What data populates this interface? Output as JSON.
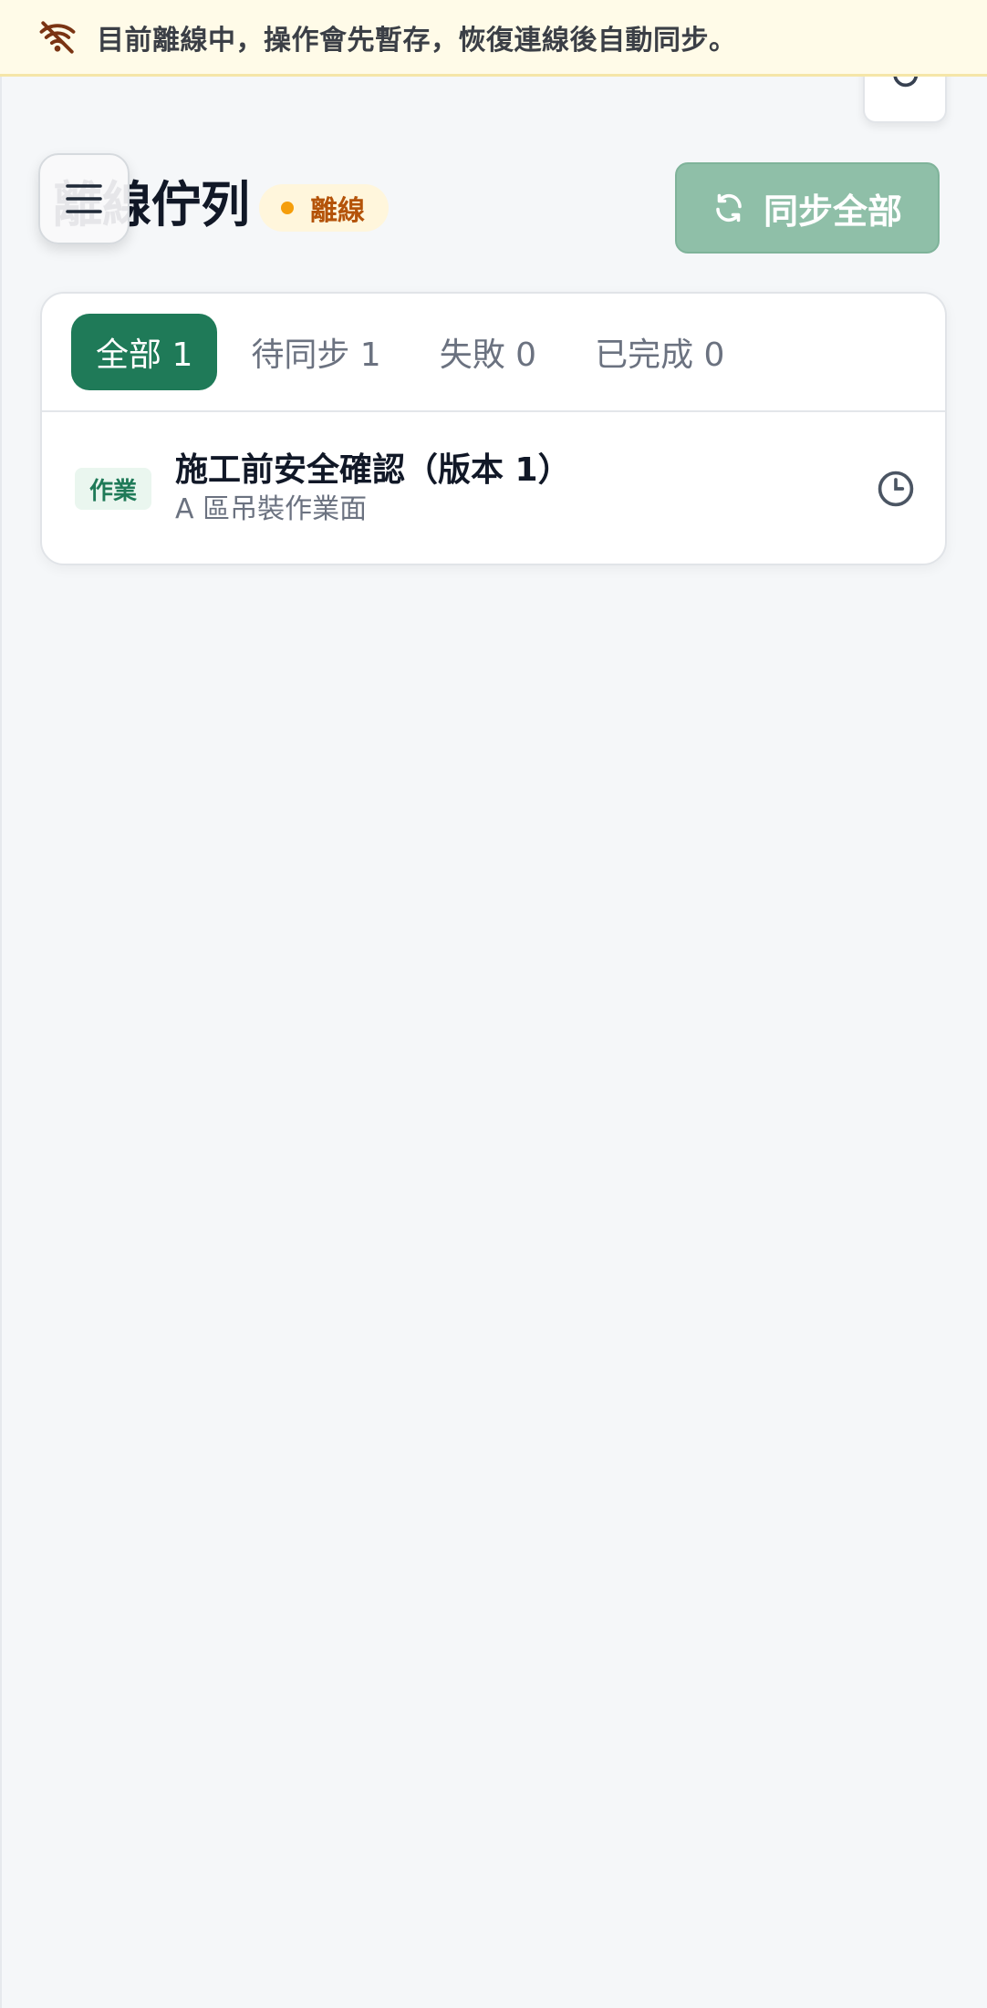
{
  "banner": {
    "icon": "wifi-off-icon",
    "text": "目前離線中，操作會先暫存，恢復連線後自動同步。"
  },
  "header": {
    "menu_icon": "hamburger-menu-icon",
    "title": "離線佇列",
    "status_label": "離線",
    "sync_all_label": "同步全部",
    "refresh_icon": "refresh-icon"
  },
  "tabs": [
    {
      "label": "全部 1",
      "active": true
    },
    {
      "label": "待同步 1",
      "active": false
    },
    {
      "label": "失敗 0",
      "active": false
    },
    {
      "label": "已完成 0",
      "active": false
    }
  ],
  "queue": [
    {
      "tag": "作業",
      "title": "施工前安全確認（版本 1）",
      "subtitle": "A 區吊裝作業面",
      "status_icon": "clock-icon"
    }
  ],
  "colors": {
    "primary": "#1f7a58",
    "primary_disabled": "#8fbfa8",
    "warning": "#f59e0b",
    "banner_bg": "#fffbe8"
  }
}
